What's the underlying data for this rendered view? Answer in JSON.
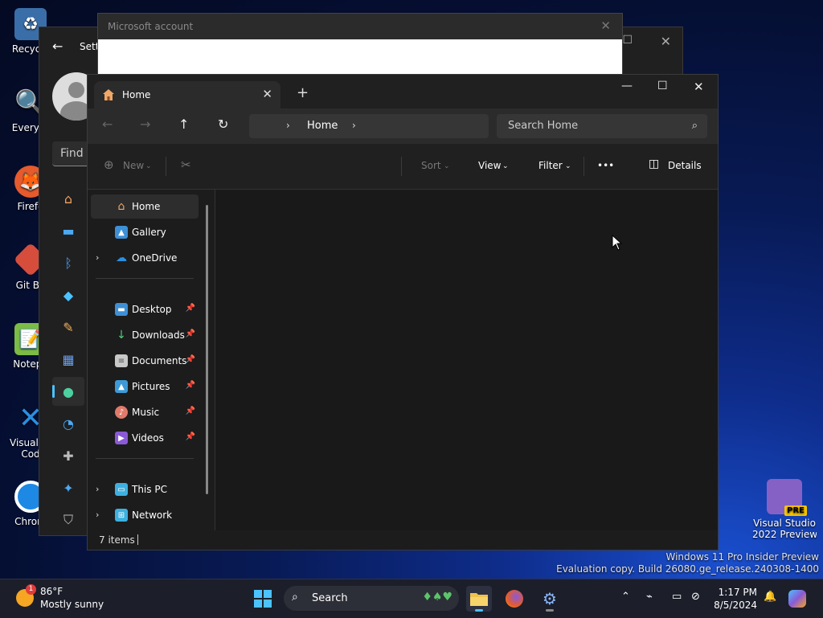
{
  "desktop": {
    "icons": [
      {
        "label": "Recycle",
        "icon": "recycle-bin-icon",
        "color": "#4a9be0"
      },
      {
        "label": "Everyth",
        "icon": "everything-search-icon",
        "color": "#f28c00"
      },
      {
        "label": "Firefo",
        "icon": "firefox-icon",
        "color": "#e55b2d"
      },
      {
        "label": "Git Ba",
        "icon": "git-bash-icon",
        "color": "#d64d3c"
      },
      {
        "label": "Notepa",
        "icon": "notepad-plus-icon",
        "color": "#7cbb45"
      },
      {
        "label": "Visual St",
        "label2": "Cod",
        "icon": "vscode-icon",
        "color": "#2a8fe0"
      },
      {
        "label": "Chrom",
        "icon": "chrome-icon",
        "color": "#1e88e5"
      }
    ],
    "vs_preview": {
      "label1": "Visual Studio",
      "label2": "2022 Preview",
      "badge": "PRE",
      "color": "#8661c5"
    }
  },
  "settings_window": {
    "title": "Setti",
    "find_placeholder": "Find a"
  },
  "ms_account_dialog": {
    "title": "Microsoft account"
  },
  "explorer": {
    "tab_label": "Home",
    "breadcrumb": "Home",
    "search_placeholder": "Search Home",
    "commands": {
      "new": "New",
      "sort": "Sort",
      "view": "View",
      "filter": "Filter",
      "more": "•••",
      "details": "Details"
    },
    "nav": [
      {
        "label": "Home",
        "icon": "home-icon",
        "selected": true
      },
      {
        "label": "Gallery",
        "icon": "gallery-icon"
      },
      {
        "label": "OneDrive",
        "icon": "onedrive-icon",
        "expandable": true
      },
      {
        "label": "Desktop",
        "icon": "desktop-folder-icon",
        "pinned": true
      },
      {
        "label": "Downloads",
        "icon": "downloads-icon",
        "pinned": true
      },
      {
        "label": "Documents",
        "icon": "documents-icon",
        "pinned": true
      },
      {
        "label": "Pictures",
        "icon": "pictures-icon",
        "pinned": true
      },
      {
        "label": "Music",
        "icon": "music-icon",
        "pinned": true
      },
      {
        "label": "Videos",
        "icon": "videos-icon",
        "pinned": true
      },
      {
        "label": "This PC",
        "icon": "this-pc-icon",
        "expandable": true
      },
      {
        "label": "Network",
        "icon": "network-icon",
        "expandable": true
      }
    ],
    "status": "7 items"
  },
  "watermark": {
    "line1": "Windows 11 Pro Insider Preview",
    "line2": "Evaluation copy. Build 26080.ge_release.240308-1400"
  },
  "taskbar": {
    "weather_temp": "86°F",
    "weather_cond": "Mostly sunny",
    "weather_badge": "1",
    "search_label": "Search",
    "time": "1:17 PM",
    "date": "8/5/2024"
  },
  "colors": {
    "accent": "#4cc2ff",
    "folder_yellow": "#f0c24b"
  }
}
